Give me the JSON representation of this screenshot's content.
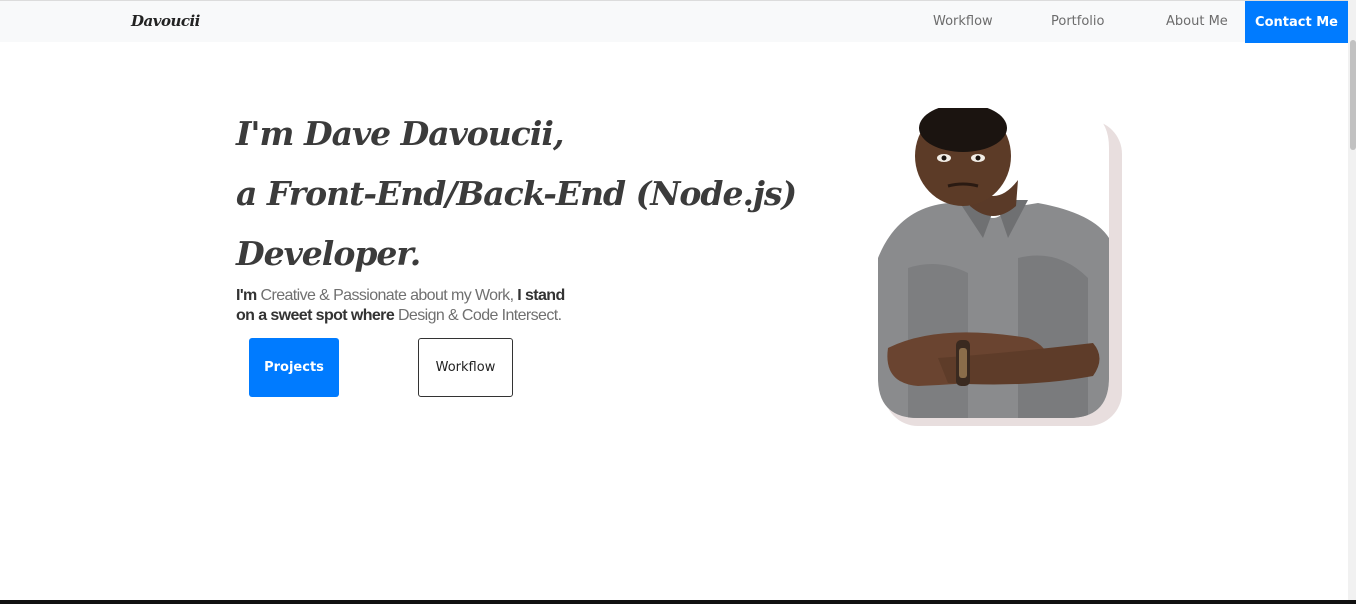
{
  "navbar": {
    "brand": "Davoucii",
    "links": [
      "Workflow",
      "Portfolio",
      "About Me"
    ],
    "contact_label": "Contact Me"
  },
  "hero": {
    "headline_lines": [
      "I'm Dave Davoucii,",
      "a Front-End/Back-End (Node.js)",
      "Developer."
    ],
    "tagline": {
      "p1": "I'm ",
      "p2": "Creative & Passionate about my Work,",
      "p3": " I stand on a sweet spot where ",
      "p4": "Design & Code Intersect."
    },
    "buttons": {
      "projects": "Projects",
      "workflow": "Workflow"
    }
  },
  "colors": {
    "accent": "#007bff",
    "navbar_bg": "#f8f9fa",
    "headline": "#3b3b3b"
  },
  "icons": {
    "portrait": "profile-photo"
  }
}
